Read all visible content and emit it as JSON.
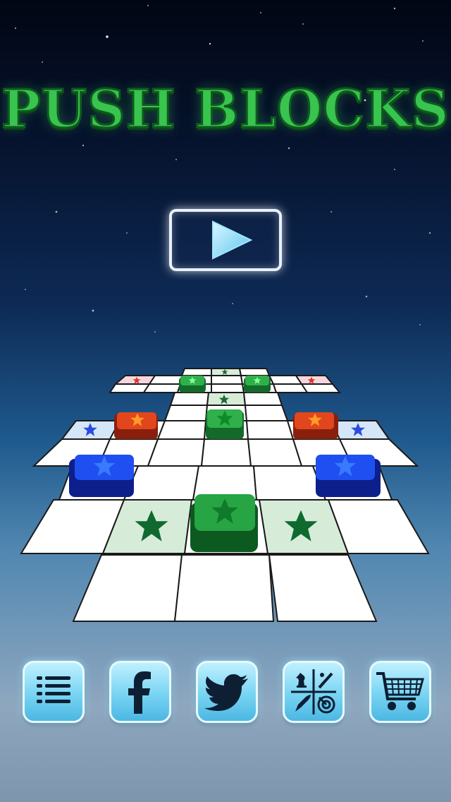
{
  "title": "PUSH BLOCKS",
  "colors": {
    "title_green": "#38c44e",
    "block_green": "#1f9a3a",
    "block_blue": "#1a3fe0",
    "block_red": "#e0401a",
    "tile_white": "#ffffff",
    "tile_green": "#d6ecd9",
    "tile_blue": "#d4e6f7",
    "tile_pink": "#f6d6de",
    "button_cyan": "#78d4f3"
  },
  "play_button": {
    "icon": "play-icon"
  },
  "toolbar": [
    {
      "id": "menu",
      "icon": "menu-list-icon"
    },
    {
      "id": "facebook",
      "icon": "facebook-icon"
    },
    {
      "id": "twitter",
      "icon": "twitter-bird-icon"
    },
    {
      "id": "more-games",
      "icon": "game-categories-icon"
    },
    {
      "id": "shop",
      "icon": "shopping-cart-icon"
    }
  ]
}
